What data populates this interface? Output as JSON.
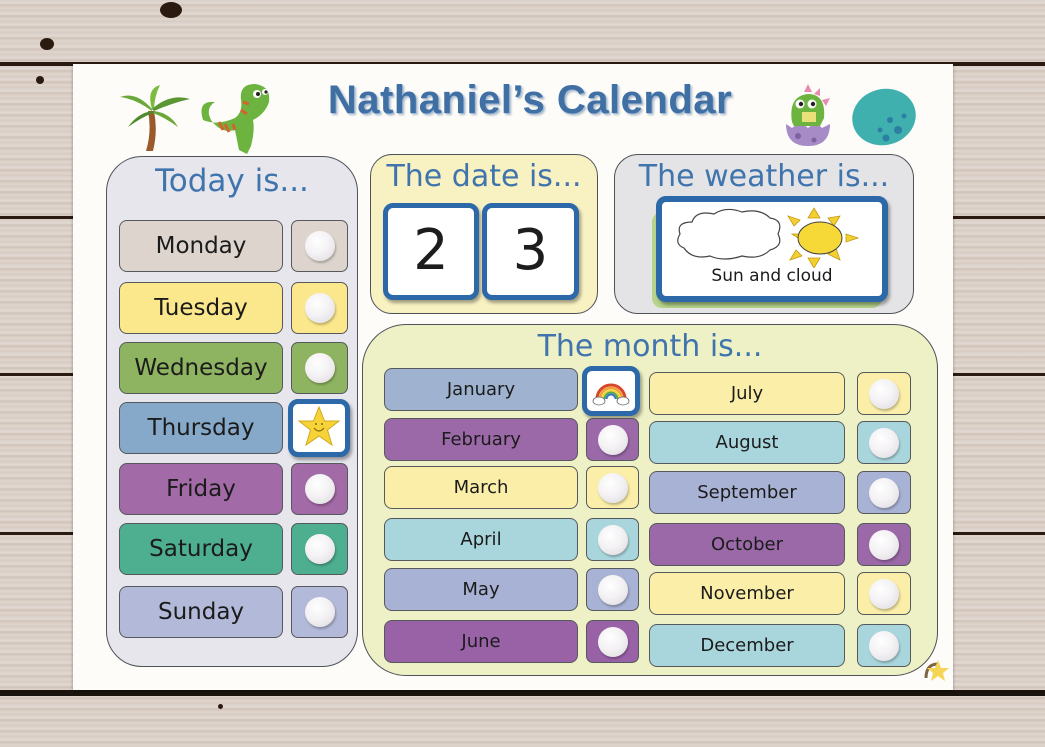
{
  "title": "Nathaniel’s Calendar",
  "decorations": [
    "palm-tree",
    "t-rex-dinosaur",
    "baby-dinosaur-in-egg",
    "spotted-egg"
  ],
  "today_panel": {
    "title": "Today is...",
    "selected_day": "Thursday",
    "selected_marker": "smiling-star-icon",
    "days": [
      {
        "label": "Monday",
        "color": "#ddd5cd"
      },
      {
        "label": "Tuesday",
        "color": "#fbe88c"
      },
      {
        "label": "Wednesday",
        "color": "#8fb461"
      },
      {
        "label": "Thursday",
        "color": "#87a9c9"
      },
      {
        "label": "Friday",
        "color": "#a26aa6"
      },
      {
        "label": "Saturday",
        "color": "#4daf8f"
      },
      {
        "label": "Sunday",
        "color": "#b3b9d8"
      }
    ]
  },
  "date_panel": {
    "title": "The date is...",
    "digits": [
      "2",
      "3"
    ]
  },
  "weather_panel": {
    "title": "The weather is...",
    "current": "Sun and cloud",
    "icon": "sun-and-cloud-icon"
  },
  "month_panel": {
    "title": "The month is...",
    "selected_month": "January",
    "selected_marker": "rainbow-icon",
    "months": [
      {
        "label": "January",
        "color": "#9fb3d1"
      },
      {
        "label": "February",
        "color": "#9b69a8"
      },
      {
        "label": "March",
        "color": "#fbeea8"
      },
      {
        "label": "April",
        "color": "#a9d6dc"
      },
      {
        "label": "May",
        "color": "#a8b2d4"
      },
      {
        "label": "June",
        "color": "#9a62a6"
      },
      {
        "label": "July",
        "color": "#fbeea8"
      },
      {
        "label": "August",
        "color": "#a9d6dc"
      },
      {
        "label": "September",
        "color": "#a8b2d4"
      },
      {
        "label": "October",
        "color": "#9b69a8"
      },
      {
        "label": "November",
        "color": "#fbeea8"
      },
      {
        "label": "December",
        "color": "#a9d6dc"
      }
    ]
  },
  "colors": {
    "title_blue": "#3f6fa3",
    "tile_border": "#2d68a8",
    "today_panel_bg": "#e6e6ec",
    "date_panel_bg": "#f8f1c2",
    "weather_panel_bg": "#e4e4e6",
    "month_panel_bg": "#eef0c6"
  }
}
